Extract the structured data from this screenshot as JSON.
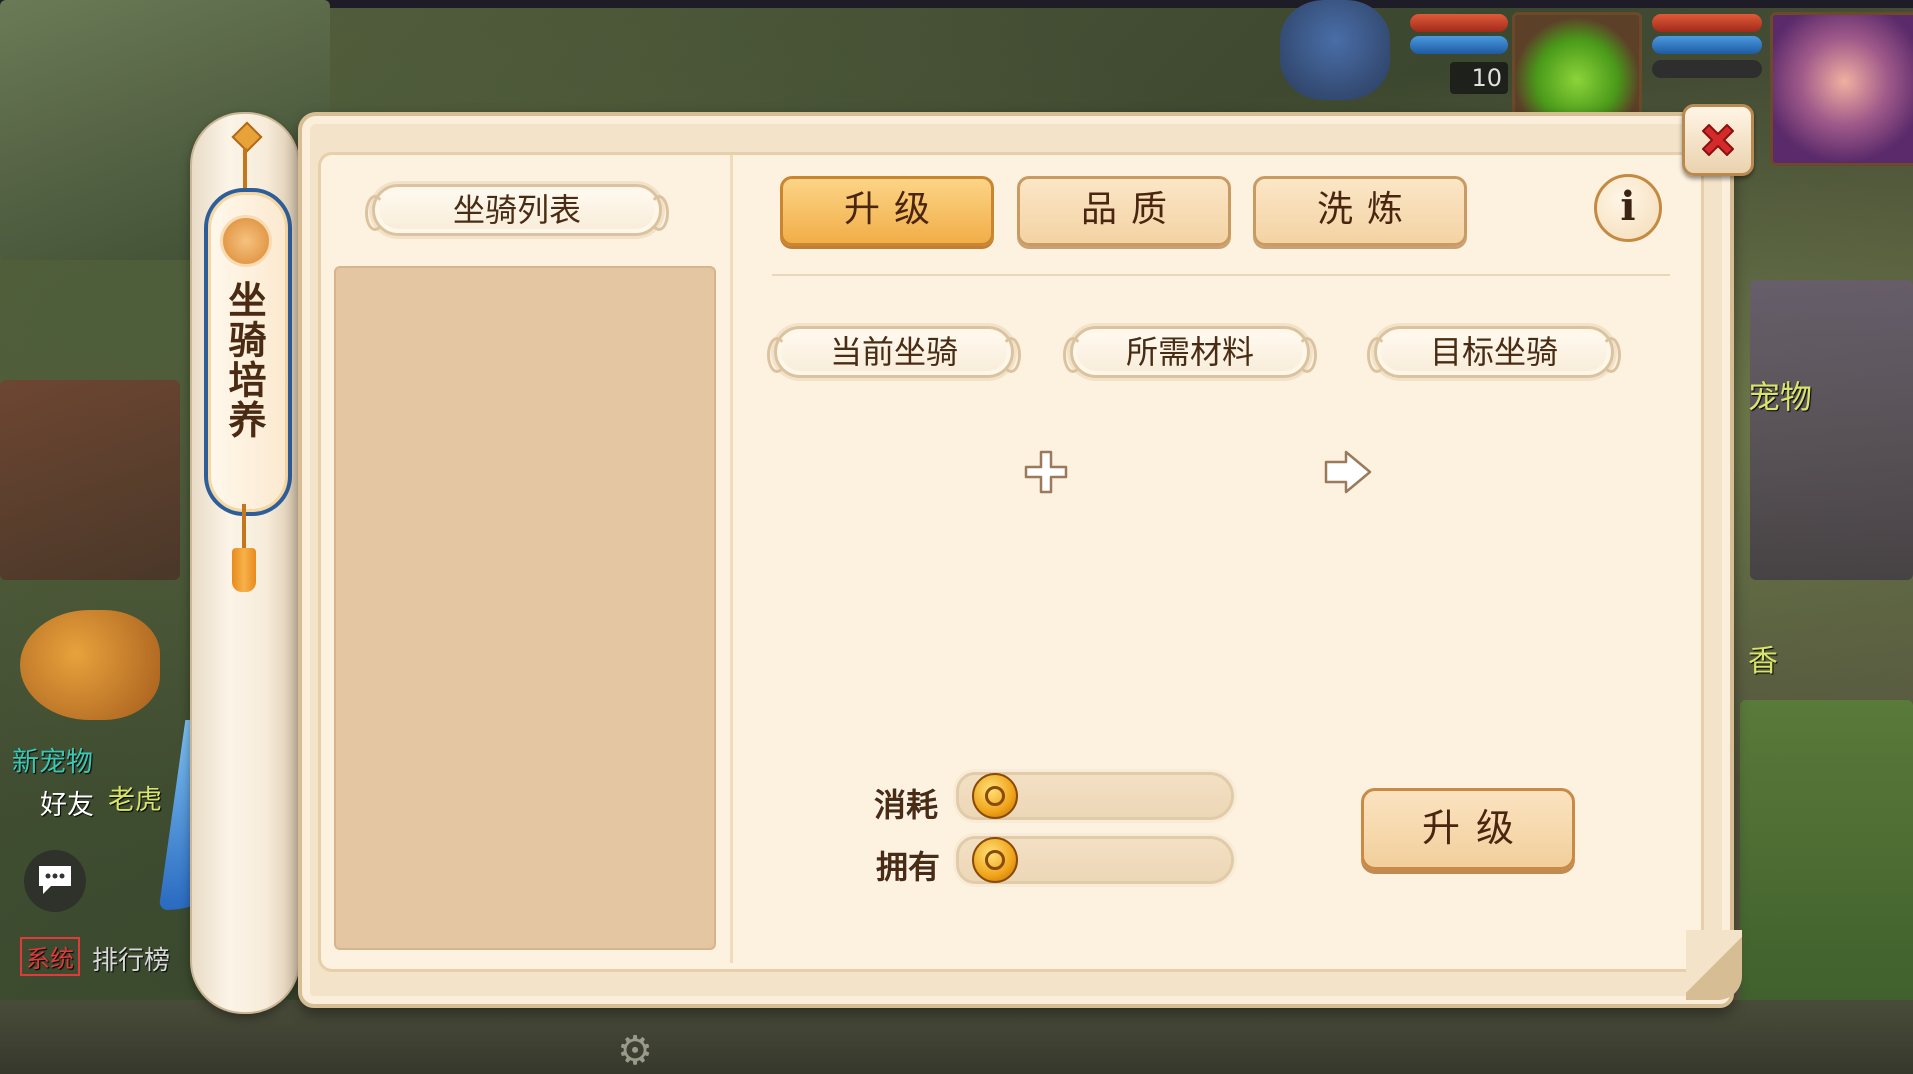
{
  "hud": {
    "pet_level": "10"
  },
  "background_text": {
    "pet": "宠物",
    "xiang": "香",
    "new_pet": "新宠物",
    "tiger": "老虎",
    "friend": "好友",
    "system_tag": "系统",
    "rank": "排行榜"
  },
  "dialog": {
    "title": "坐骑培养",
    "list_header": "坐骑列表",
    "tabs": [
      {
        "label": "升级",
        "active": true
      },
      {
        "label": "品质",
        "active": false
      },
      {
        "label": "洗炼",
        "active": false
      }
    ],
    "info_label": "i",
    "slots": {
      "current": "当前坐骑",
      "materials": "所需材料",
      "target": "目标坐骑"
    },
    "cost": {
      "consume_label": "消耗",
      "consume_value": "",
      "own_label": "拥有",
      "own_value": ""
    },
    "upgrade_button": "升级"
  },
  "colors": {
    "panel": "#f3e3c8",
    "tab_active": "#f1ae48",
    "close_x": "#d42a2a",
    "title_border": "#2e5e9a"
  },
  "icons": [
    "close-icon",
    "info-icon",
    "plus-icon",
    "arrow-right-icon",
    "coin-icon",
    "chat-icon",
    "gear-icon"
  ]
}
